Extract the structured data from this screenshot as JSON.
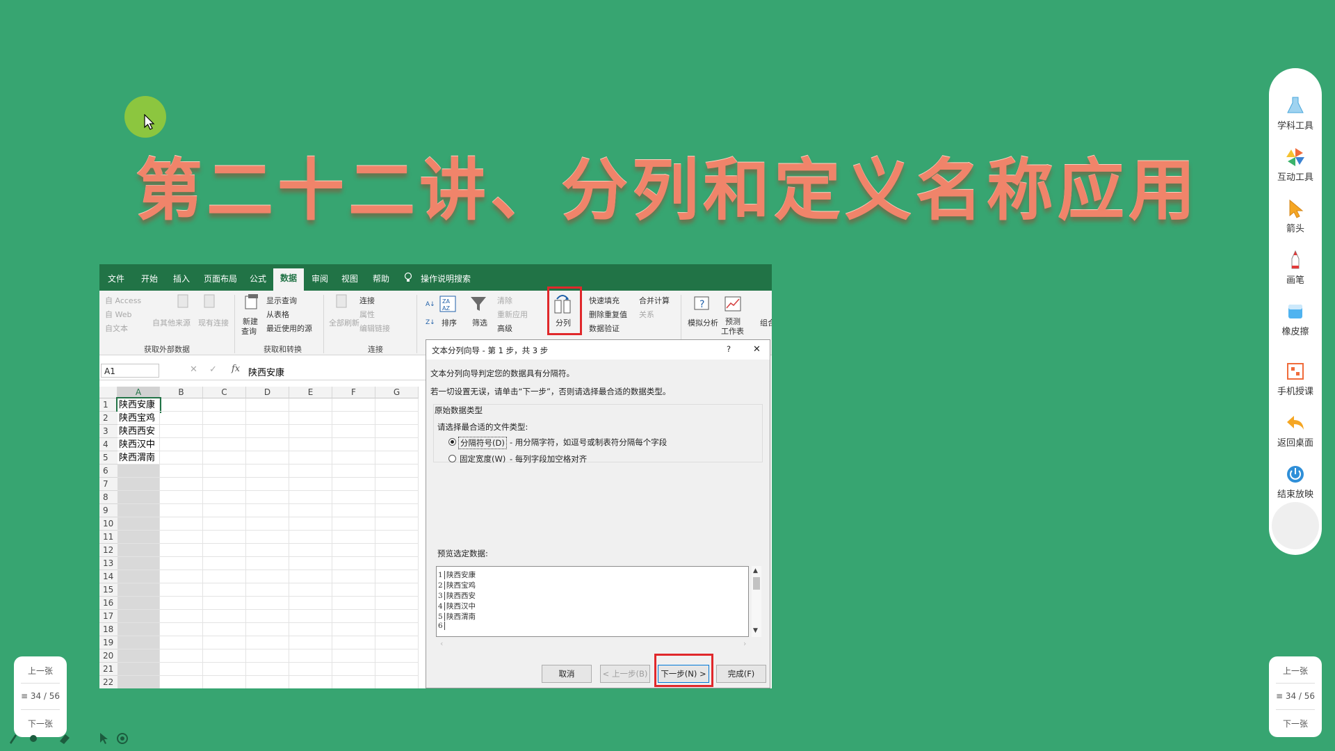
{
  "slide": {
    "title": "第二十二讲、分列和定义名称应用"
  },
  "excel": {
    "tabs": [
      "文件",
      "开始",
      "插入",
      "页面布局",
      "公式",
      "数据",
      "审阅",
      "视图",
      "帮助"
    ],
    "active_tab": "数据",
    "tell_me": "操作说明搜索",
    "ribbon": {
      "access": "自 Access",
      "web": "自 Web",
      "text": "自文本",
      "other_sources": "自其他来源",
      "existing_conn": "现有连接",
      "group_external": "获取外部数据",
      "new_query_1": "新建",
      "new_query_2": "查询",
      "show_queries": "显示查询",
      "from_table": "从表格",
      "recent_sources": "最近使用的源",
      "group_transform": "获取和转换",
      "refresh_all": "全部刷新",
      "connections": "连接",
      "properties": "属性",
      "edit_links": "编辑链接",
      "group_connections": "连接",
      "sort": "排序",
      "filter": "筛选",
      "clear": "清除",
      "reapply": "重新应用",
      "advanced": "高级",
      "text_to_columns": "分列",
      "flash_fill": "快速填充",
      "remove_dup": "删除重复值",
      "data_validation": "数据验证",
      "consolidate": "合并计算",
      "relations": "关系",
      "what_if": "模拟分析",
      "forecast_1": "预测",
      "forecast_2": "工作表",
      "group": "组合"
    },
    "name_box": "A1",
    "formula_value": "陕西安康",
    "columns": [
      "A",
      "B",
      "C",
      "D",
      "E",
      "F",
      "G"
    ],
    "rows": [
      "1",
      "2",
      "3",
      "4",
      "5",
      "6",
      "7",
      "8",
      "9",
      "10",
      "11",
      "12",
      "13",
      "14",
      "15",
      "16",
      "17",
      "18",
      "19",
      "20",
      "21",
      "22"
    ],
    "cells_a": [
      "陕西安康",
      "陕西宝鸡",
      "陕西西安",
      "陕西汉中",
      "陕西渭南"
    ]
  },
  "dialog": {
    "title": "文本分列向导 - 第 1 步，共 3 步",
    "help": "?",
    "close": "✕",
    "line1": "文本分列向导判定您的数据具有分隔符。",
    "line2": "若一切设置无误，请单击“下一步”，否则请选择最合适的数据类型。",
    "section": "原始数据类型",
    "choose": "请选择最合适的文件类型:",
    "opt1": "分隔符号(D)",
    "opt1_desc": "- 用分隔字符，如逗号或制表符分隔每个字段",
    "opt2": "固定宽度(W)",
    "opt2_desc": "- 每列字段加空格对齐",
    "preview_label": "预览选定数据:",
    "preview_nums": [
      "1",
      "2",
      "3",
      "4",
      "5",
      "6"
    ],
    "preview_rows": [
      "陕西安康",
      "陕西宝鸡",
      "陕西西安",
      "陕西汉中",
      "陕西渭南",
      ""
    ],
    "btn_cancel": "取消",
    "btn_prev": "< 上一步(B)",
    "btn_next": "下一步(N) >",
    "btn_finish": "完成(F)"
  },
  "toolbar": {
    "items": [
      "学科工具",
      "互动工具",
      "箭头",
      "画笔",
      "橡皮擦",
      "手机授课",
      "返回桌面",
      "结束放映"
    ]
  },
  "pager": {
    "prev": "上一张",
    "page": "34 / 56",
    "next": "下一张"
  },
  "colors": {
    "background": "#37a571",
    "excel_green": "#217346",
    "title": "#f0846a",
    "highlight": "#e0282b"
  }
}
